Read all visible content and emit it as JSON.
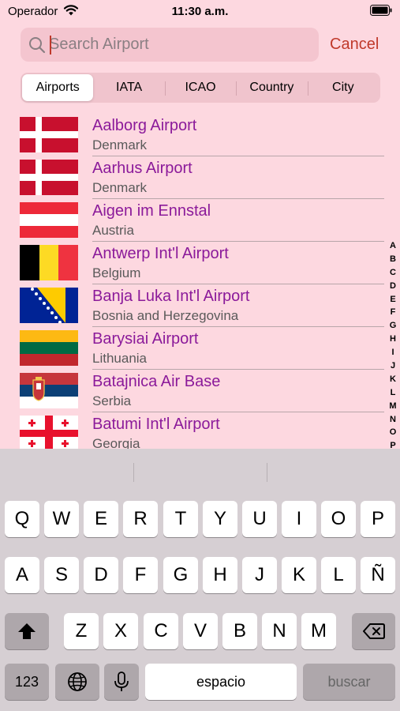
{
  "status": {
    "carrier": "Operador",
    "time": "11:30 a.m."
  },
  "search": {
    "placeholder": "Search Airport",
    "cancel": "Cancel"
  },
  "segments": [
    "Airports",
    "IATA",
    "ICAO",
    "Country",
    "City"
  ],
  "airports": [
    {
      "name": "Aalborg Airport",
      "country": "Denmark",
      "flag": "denmark"
    },
    {
      "name": "Aarhus Airport",
      "country": "Denmark",
      "flag": "denmark"
    },
    {
      "name": "Aigen im Ennstal",
      "country": "Austria",
      "flag": "austria"
    },
    {
      "name": "Antwerp Int'l Airport",
      "country": "Belgium",
      "flag": "belgium"
    },
    {
      "name": "Banja Luka Int'l Airport",
      "country": "Bosnia and Herzegovina",
      "flag": "bosnia"
    },
    {
      "name": "Barysiai Airport",
      "country": "Lithuania",
      "flag": "lithuania"
    },
    {
      "name": "Batajnica Air Base",
      "country": "Serbia",
      "flag": "serbia"
    },
    {
      "name": "Batumi Int'l Airport",
      "country": "Georgia",
      "flag": "georgia"
    }
  ],
  "index_letters": [
    "A",
    "B",
    "C",
    "D",
    "E",
    "F",
    "G",
    "H",
    "I",
    "J",
    "K",
    "L",
    "M",
    "N",
    "O",
    "P"
  ],
  "keyboard": {
    "row1": [
      "Q",
      "W",
      "E",
      "R",
      "T",
      "Y",
      "U",
      "I",
      "O",
      "P"
    ],
    "row2": [
      "A",
      "S",
      "D",
      "F",
      "G",
      "H",
      "J",
      "K",
      "L",
      "Ñ"
    ],
    "row3": [
      "Z",
      "X",
      "C",
      "V",
      "B",
      "N",
      "M"
    ],
    "numbers_key": "123",
    "space_key": "espacio",
    "return_key": "buscar"
  },
  "colors": {
    "background": "#fdd8e0",
    "accent": "#c0392b",
    "airport_name": "#8b1a9a"
  }
}
